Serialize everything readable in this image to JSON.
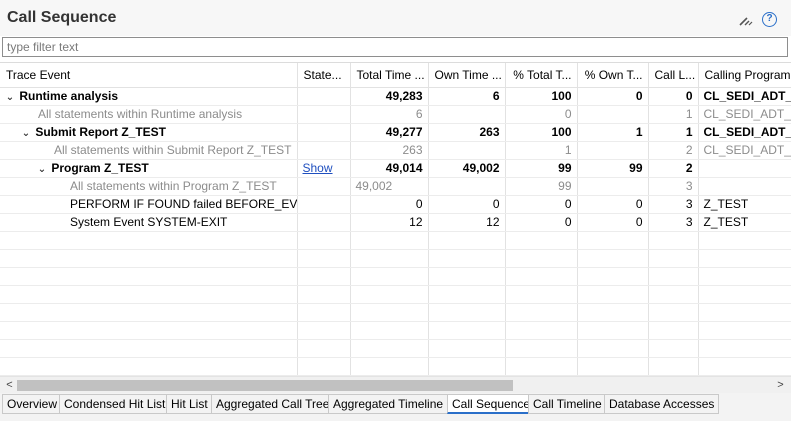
{
  "header": {
    "title": "Call Sequence",
    "help_glyph": "?",
    "icons": [
      "wand-icon",
      "help-icon"
    ]
  },
  "filter": {
    "placeholder": "type filter text",
    "value": ""
  },
  "table": {
    "columns": [
      "Trace Event",
      "State...",
      "Total Time ...",
      "Own Time ...",
      "% Total T...",
      "% Own T...",
      "Call L...",
      "Calling Program"
    ],
    "rows": [
      {
        "event": "Runtime analysis",
        "state": "",
        "total": "49,283",
        "own": "6",
        "pct_total": "100",
        "pct_own": "0",
        "call_level": "0",
        "calling": "CL_SEDI_ADT_PI"
      },
      {
        "event": "All statements within Runtime analysis",
        "state": "",
        "total": "6",
        "own": "",
        "pct_total": "0",
        "pct_own": "",
        "call_level": "1",
        "calling": "CL_SEDI_ADT_PR"
      },
      {
        "event": "Submit Report  Z_TEST",
        "state": "",
        "total": "49,277",
        "own": "263",
        "pct_total": "100",
        "pct_own": "1",
        "call_level": "1",
        "calling": "CL_SEDI_ADT_PI"
      },
      {
        "event": "All statements within Submit Report  Z_TEST",
        "state": "",
        "total": "263",
        "own": "",
        "pct_total": "1",
        "pct_own": "",
        "call_level": "2",
        "calling": "CL_SEDI_ADT_PR"
      },
      {
        "event": "Program  Z_TEST",
        "state": "Show",
        "total": "49,014",
        "own": "49,002",
        "pct_total": "99",
        "pct_own": "99",
        "call_level": "2",
        "calling": ""
      },
      {
        "event": "All statements within Program  Z_TEST",
        "state": "",
        "total": "49,002",
        "own": "",
        "pct_total": "99",
        "pct_own": "",
        "call_level": "3",
        "calling": ""
      },
      {
        "event": "PERFORM IF FOUND failed  BEFORE_EVENT",
        "state": "",
        "total": "0",
        "own": "0",
        "pct_total": "0",
        "pct_own": "0",
        "call_level": "3",
        "calling": "Z_TEST"
      },
      {
        "event": "System Event  SYSTEM-EXIT",
        "state": "",
        "total": "12",
        "own": "12",
        "pct_total": "0",
        "pct_own": "0",
        "call_level": "3",
        "calling": "Z_TEST"
      }
    ],
    "expand_glyph": "⌄"
  },
  "scrollbar": {
    "left_arrow": "<",
    "right_arrow": ">"
  },
  "tabs": [
    {
      "label": "Overview",
      "active": false
    },
    {
      "label": "Condensed Hit List",
      "active": false
    },
    {
      "label": "Hit List",
      "active": false
    },
    {
      "label": "Aggregated Call Tree",
      "active": false
    },
    {
      "label": "Aggregated Timeline",
      "active": false
    },
    {
      "label": "Call Sequence",
      "active": true
    },
    {
      "label": "Call Timeline",
      "active": false
    },
    {
      "label": "Database Accesses",
      "active": false
    }
  ]
}
